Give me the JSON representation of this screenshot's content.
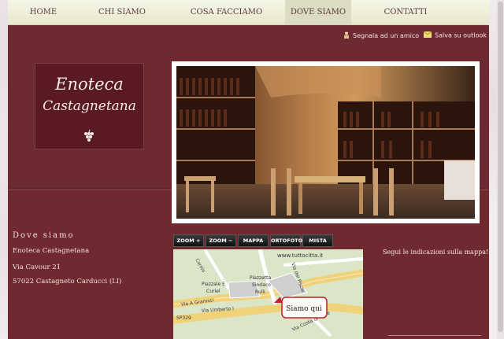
{
  "nav": {
    "items": [
      {
        "label": "HOME",
        "active": false
      },
      {
        "label": "CHI SIAMO",
        "active": false
      },
      {
        "label": "COSA FACCIAMO",
        "active": false
      },
      {
        "label": "DOVE SIAMO",
        "active": true
      },
      {
        "label": "CONTATTI",
        "active": false
      }
    ]
  },
  "utility": {
    "recommend": "Segnala ad un amico",
    "outlook": "Salva su outlook"
  },
  "logo": {
    "line1": "Enoteca",
    "line2": "Castagnetana"
  },
  "location": {
    "title": "Dove siamo",
    "name": "Enoteca Castagnetana",
    "street": "Via Cavour 21",
    "city": "57022 Castagneto Carducci (LI)"
  },
  "map_controls": {
    "zoom_in": "ZOOM +",
    "zoom_out": "ZOOM −",
    "map": "MAPPA",
    "ortho": "ORTOFOTO",
    "mixed": "MISTA"
  },
  "map": {
    "source": "www.tuttocitta.it",
    "marker_label": "Siamo qui",
    "labels": {
      "carolo": "Carolo",
      "piazzale": "Piazzale E.",
      "curiel": "Curiel",
      "piazzetta": "Piazzetta",
      "sindaco": "Sindaco",
      "rulli": "Rulli",
      "gramsci": "Via A Gramsci",
      "umberto": "Via Umberto I",
      "sp329": "SP329",
      "costa": "Via Costa di Mare",
      "piscio": "Via del Piscio"
    }
  },
  "hint": "Segui le indicazioni sulla mappa!",
  "colors": {
    "panel": "#702a2f",
    "nav_bg": "#f0f0dc",
    "nav_text": "#5b3a3f"
  }
}
